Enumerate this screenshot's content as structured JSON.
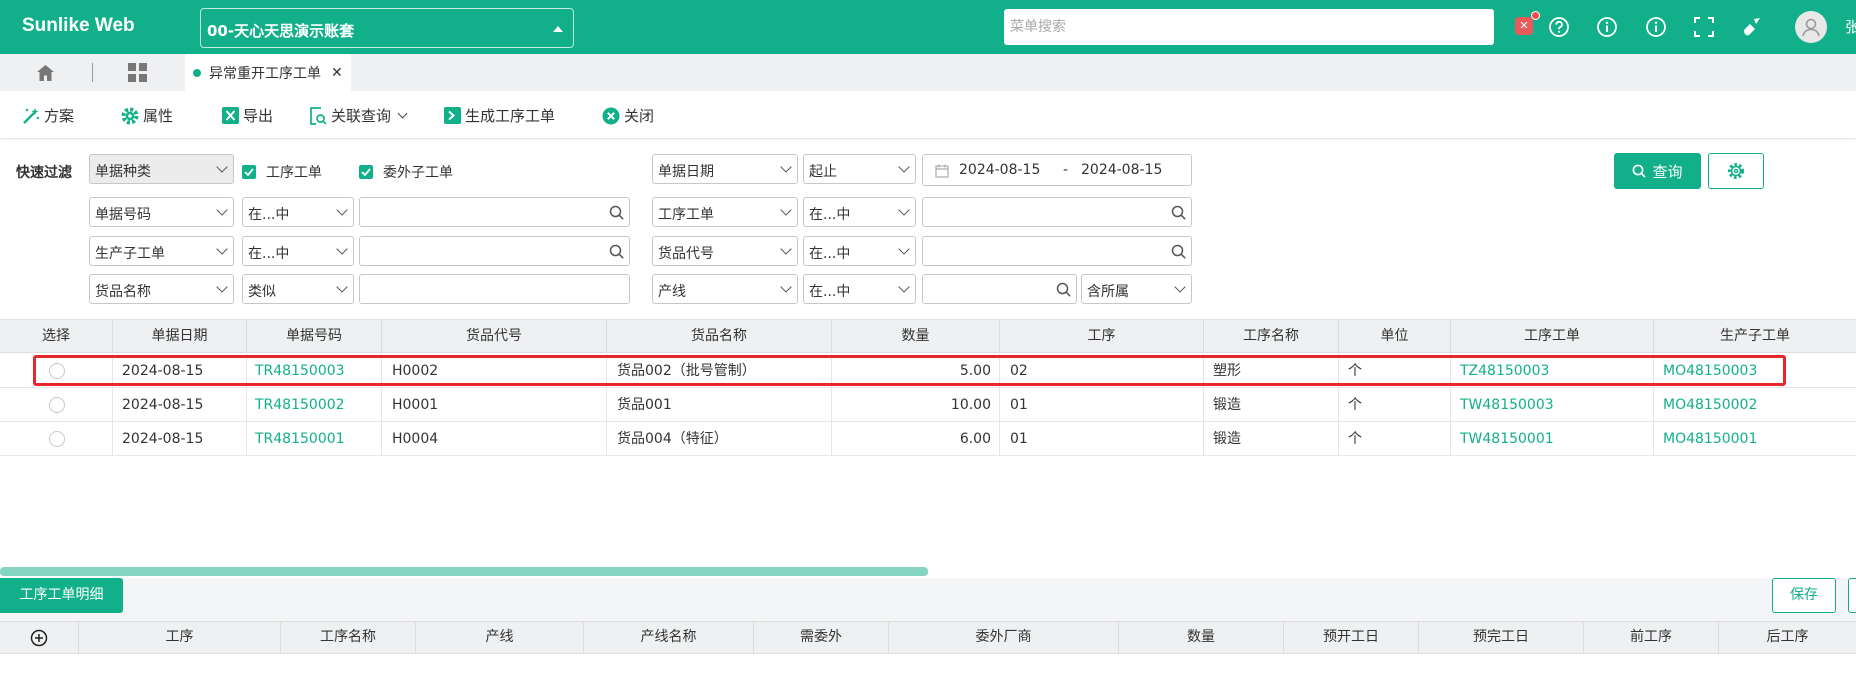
{
  "app": {
    "brand": "Sunlike Web",
    "account": "00-天心天思演示账套",
    "menu_search_placeholder": "菜单搜索",
    "user_initial": "张"
  },
  "colors": {
    "primary": "#12b08a",
    "highlight_border": "#e8262b",
    "badge": "#e85b5b"
  },
  "icons": {
    "notifications": "notification-icon",
    "help": "help-icon",
    "info": "info-icon",
    "fullscreen": "fullscreen-icon",
    "clean": "broom-icon",
    "avatar": "avatar-icon"
  },
  "tabs": {
    "active_tab": "异常重开工序工单"
  },
  "toolbar": {
    "plan": "方案",
    "properties": "属性",
    "export": "导出",
    "related_query": "关联查询",
    "generate": "生成工序工单",
    "close": "关闭"
  },
  "filter": {
    "label": "快速过滤",
    "doc_type": "单据种类",
    "chk_process_order": "工序工单",
    "chk_outsource_sub": "委外子工单",
    "doc_date": "单据日期",
    "range": "起止",
    "date_from": "2024-08-15",
    "date_sep": "-",
    "date_to": "2024-08-15",
    "query": "查询",
    "rows": {
      "r1_field": "单据号码",
      "r1_op": "在...中",
      "r2_field": "生产子工单",
      "r2_op": "在...中",
      "r3_field": "货品名称",
      "r3_op": "类似",
      "c2_r1_field": "工序工单",
      "c2_r1_op": "在...中",
      "c2_r2_field": "货品代号",
      "c2_r2_op": "在...中",
      "c2_r3_field": "产线",
      "c2_r3_op": "在...中",
      "include_sub": "含所属"
    }
  },
  "grid": {
    "headers": [
      "选择",
      "单据日期",
      "单据号码",
      "货品代号",
      "货品名称",
      "数量",
      "工序",
      "工序名称",
      "单位",
      "工序工单",
      "生产子工单"
    ],
    "rows": [
      {
        "date": "2024-08-15",
        "doc_no": "TR48150003",
        "item_code": "H0002",
        "item_name": "货品002（批号管制）",
        "qty": "5.00",
        "process": "02",
        "process_name": "塑形",
        "unit": "个",
        "process_order": "TZ48150003",
        "sub_order": "MO48150003"
      },
      {
        "date": "2024-08-15",
        "doc_no": "TR48150002",
        "item_code": "H0001",
        "item_name": "货品001",
        "qty": "10.00",
        "process": "01",
        "process_name": "锻造",
        "unit": "个",
        "process_order": "TW48150003",
        "sub_order": "MO48150002"
      },
      {
        "date": "2024-08-15",
        "doc_no": "TR48150001",
        "item_code": "H0004",
        "item_name": "货品004（特征）",
        "qty": "6.00",
        "process": "01",
        "process_name": "锻造",
        "unit": "个",
        "process_order": "TW48150001",
        "sub_order": "MO48150001"
      }
    ]
  },
  "detail": {
    "tab": "工序工单明细",
    "save": "保存",
    "headers": [
      "工序",
      "工序名称",
      "产线",
      "产线名称",
      "需委外",
      "委外厂商",
      "数量",
      "预开工日",
      "预完工日",
      "前工序",
      "后工序"
    ]
  }
}
